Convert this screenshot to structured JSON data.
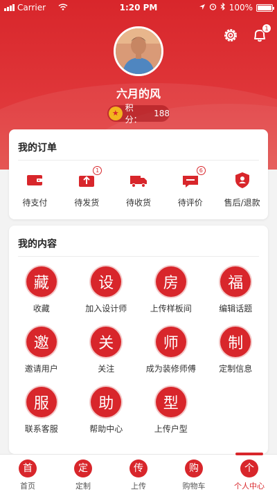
{
  "status": {
    "carrier": "Carrier",
    "time": "1:20 PM",
    "battery": "100%"
  },
  "profile": {
    "name": "六月的风",
    "points_label": "积分：",
    "points_value": "188"
  },
  "notifications": {
    "badge": "1"
  },
  "orders": {
    "title": "我的订单",
    "items": [
      {
        "label": "待支付",
        "badge": ""
      },
      {
        "label": "待发货",
        "badge": "1"
      },
      {
        "label": "待收货",
        "badge": ""
      },
      {
        "label": "待评价",
        "badge": "6"
      },
      {
        "label": "售后/退款",
        "badge": ""
      }
    ]
  },
  "content": {
    "title": "我的内容",
    "items": [
      {
        "label": "收藏",
        "icon": "collect-icon"
      },
      {
        "label": "加入设计师",
        "icon": "designer-icon"
      },
      {
        "label": "上传样板间",
        "icon": "upload-room-icon"
      },
      {
        "label": "编辑话题",
        "icon": "edit-topic-icon"
      },
      {
        "label": "邀请用户",
        "icon": "invite-icon"
      },
      {
        "label": "关注",
        "icon": "follow-icon"
      },
      {
        "label": "成为装修师傅",
        "icon": "worker-icon"
      },
      {
        "label": "定制信息",
        "icon": "custom-info-icon"
      },
      {
        "label": "联系客服",
        "icon": "service-icon"
      },
      {
        "label": "帮助中心",
        "icon": "help-icon"
      },
      {
        "label": "上传户型",
        "icon": "upload-plan-icon"
      }
    ]
  },
  "tabbar": {
    "items": [
      {
        "label": "首页"
      },
      {
        "label": "定制"
      },
      {
        "label": "上传"
      },
      {
        "label": "购物车"
      },
      {
        "label": "个人中心",
        "active": true
      }
    ]
  },
  "colors": {
    "brand": "#d8262b",
    "background": "#f3f3f3"
  }
}
